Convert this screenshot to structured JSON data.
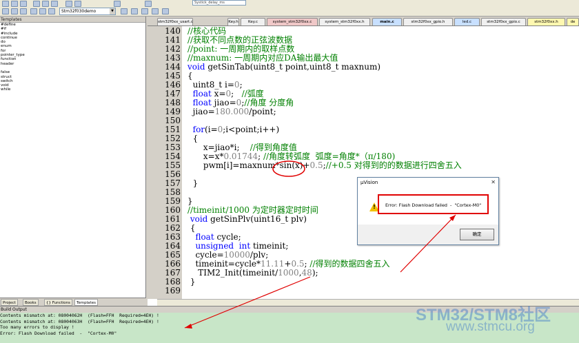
{
  "toolbar": {
    "target": "Stm32f030demo",
    "top_dropdown": "Systick_delay_ms"
  },
  "templates_panel": {
    "title": "Templates",
    "items": [
      "#define",
      "#if",
      "#include",
      "continue",
      "do",
      "enum",
      "for",
      "pointer_type",
      "function",
      "header",
      "",
      "false",
      "struct",
      "switch",
      "void",
      "while"
    ],
    "tabs": [
      "Project",
      "Books",
      "{} Functions",
      "Templates"
    ]
  },
  "file_tabs": [
    {
      "label": "stm32f0xx_usart.c"
    },
    {
      "label": "Key.h"
    },
    {
      "label": "Key.c"
    },
    {
      "label": "system_stm32f0xx.c"
    },
    {
      "label": "system_stm32f0xx.h"
    },
    {
      "label": "main.c"
    },
    {
      "label": "stm32f0xx_gpio.h"
    },
    {
      "label": "led.c"
    },
    {
      "label": "stm32f0xx_gpio.c"
    },
    {
      "label": "stm32f0xx.h"
    },
    {
      "label": "de"
    }
  ],
  "code_lines": [
    {
      "n": "140",
      "text": "//核心代码"
    },
    {
      "n": "141",
      "text": "//获取不同点数的正弦波数据"
    },
    {
      "n": "142",
      "text": "//point: 一周期内的取样点数"
    },
    {
      "n": "143",
      "text": "//maxnum: 一周期内对应DA输出最大值"
    },
    {
      "n": "144",
      "text": "void getSinTab(uint8_t point,uint8_t maxnum)"
    },
    {
      "n": "145",
      "text": "{"
    },
    {
      "n": "146",
      "text": "  uint8_t i=0;"
    },
    {
      "n": "147",
      "text": "  float x=0;   //弧度"
    },
    {
      "n": "148",
      "text": "  float jiao=0;//角度 分度角"
    },
    {
      "n": "149",
      "text": "  jiao=180.000/point;"
    },
    {
      "n": "150",
      "text": ""
    },
    {
      "n": "151",
      "text": "  for(i=0;i<point;i++)"
    },
    {
      "n": "152",
      "text": "  {"
    },
    {
      "n": "153",
      "text": "      x=jiao*i;    //得到角度值"
    },
    {
      "n": "154",
      "text": "      x=x*0.01744; //角度转弧度  弧度=角度*（π/180)"
    },
    {
      "n": "155",
      "text": "      pwm[i]=maxnum*sin(x)+0.5;//+0.5 对得到的的数据进行四舍五入"
    },
    {
      "n": "156",
      "text": ""
    },
    {
      "n": "157",
      "text": "  }"
    },
    {
      "n": "158",
      "text": ""
    },
    {
      "n": "159",
      "text": "}"
    },
    {
      "n": "160",
      "text": "//timeinit/1000 为定时器定时时间"
    },
    {
      "n": "161",
      "text": " void getSinPlv(uint16_t plv)"
    },
    {
      "n": "162",
      "text": " {"
    },
    {
      "n": "163",
      "text": "   float cycle;"
    },
    {
      "n": "164",
      "text": "   unsigned  int timeinit;"
    },
    {
      "n": "165",
      "text": "   cycle=10000/plv;"
    },
    {
      "n": "166",
      "text": "   timeinit=cycle*11.11+0.5; //得到的数据四舍五入"
    },
    {
      "n": "167",
      "text": "    TIM2_Init(timeinit/1000,48);"
    },
    {
      "n": "168",
      "text": " }"
    },
    {
      "n": "169",
      "text": ""
    }
  ],
  "output": {
    "title": "Build Output",
    "lines": [
      "Contents mismatch at: 08004062H  (Flash=FFH  Required=4EH) !",
      "Contents mismatch at: 08004063H  (Flash=FFH  Required=4EH) !",
      "Too many errors to display !",
      "Error: Flash Download failed  -  \"Cortex-M0\""
    ]
  },
  "dialog": {
    "title": "µVision",
    "close": "✕",
    "message": "Error: Flash Download failed  -  \"Cortex-M0\"",
    "ok_label": "确定"
  },
  "watermark": {
    "brand": "STM32/STM8社区",
    "url": "www.stmcu.org"
  },
  "colors": {
    "keyword": "#0000ff",
    "comment": "#008000",
    "annotation": "#e00000",
    "output_bg": "#c8e6c8"
  }
}
